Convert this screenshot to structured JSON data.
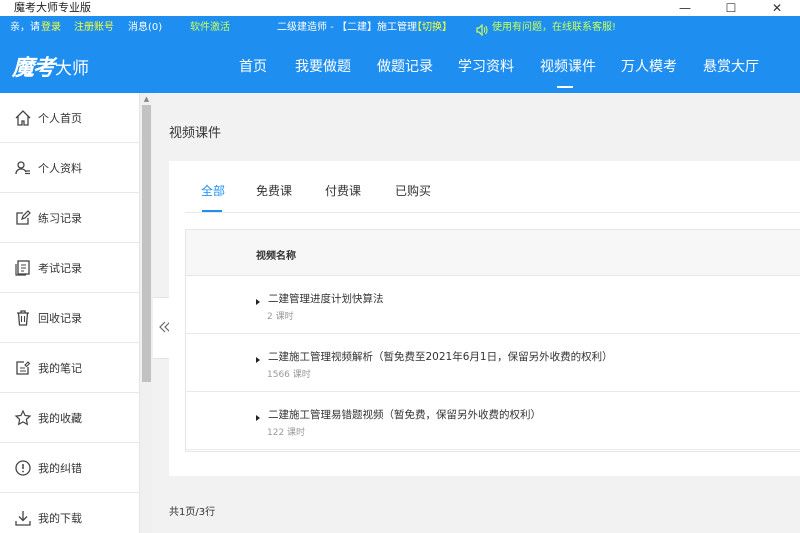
{
  "window": {
    "title": "魔考大师专业版",
    "minimize": "—",
    "maximize": "☐",
    "close": "✕"
  },
  "infobar": {
    "greeting": "亲，请",
    "login": "登录",
    "register": "注册账号",
    "messages": "消息(0)",
    "activate": "软件激活",
    "exam_name": "二级建造师 - 【二建】施工管理",
    "switch": "【切换】",
    "help": "使用有问题，在线联系客服!"
  },
  "logo": {
    "script": "魔考",
    "tail": "大师"
  },
  "nav": {
    "items": [
      "首页",
      "我要做题",
      "做题记录",
      "学习资料",
      "视频课件",
      "万人模考",
      "悬赏大厅"
    ],
    "active_index": 4
  },
  "sidebar": {
    "items": [
      {
        "label": "个人首页",
        "icon": "home-icon"
      },
      {
        "label": "个人资料",
        "icon": "user-profile-icon"
      },
      {
        "label": "练习记录",
        "icon": "edit-icon"
      },
      {
        "label": "考试记录",
        "icon": "exam-record-icon"
      },
      {
        "label": "回收记录",
        "icon": "trash-icon"
      },
      {
        "label": "我的笔记",
        "icon": "note-icon"
      },
      {
        "label": "我的收藏",
        "icon": "star-icon"
      },
      {
        "label": "我的纠错",
        "icon": "alert-icon"
      },
      {
        "label": "我的下载",
        "icon": "download-icon"
      }
    ]
  },
  "main": {
    "title": "视频课件",
    "tabs": [
      "全部",
      "免费课",
      "付费课",
      "已购买"
    ],
    "active_tab": 0,
    "table": {
      "header": "视频名称",
      "rows": [
        {
          "name": "二建管理进度计划快算法",
          "count": "2 课时"
        },
        {
          "name": "二建施工管理视频解析（暂免费至2021年6月1日，保留另外收费的权利）",
          "count": "1566 课时"
        },
        {
          "name": "二建施工管理易错题视频（暂免费，保留另外收费的权利）",
          "count": "122 课时"
        }
      ]
    },
    "pagination": "共1页/3行"
  },
  "colors": {
    "brand_blue": "#1e8ff0",
    "accent_yellow": "#f5ff3a",
    "accent_green": "#c8ff58"
  }
}
